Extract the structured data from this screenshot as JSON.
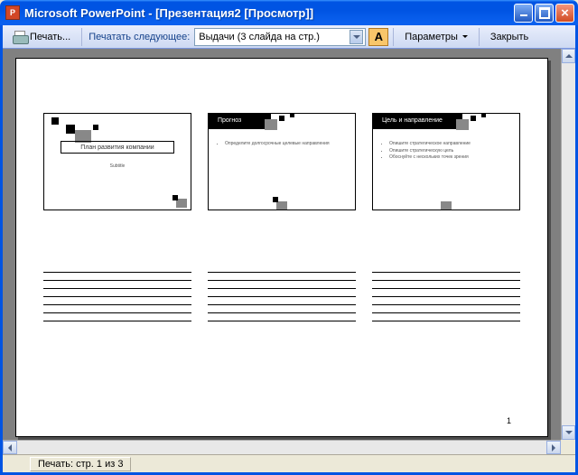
{
  "titlebar": {
    "title": "Microsoft PowerPoint - [Презентация2 [Просмотр]]"
  },
  "toolbar": {
    "print_label": "Печать...",
    "print_next_label": "Печатать следующее:",
    "select_value": "Выдачи (3 слайда на стр.)",
    "format_icon_text": "A",
    "params_label": "Параметры",
    "close_label": "Закрыть"
  },
  "page": {
    "number": "1"
  },
  "slides": [
    {
      "title": "План развития компании",
      "subtitle": "Subtitle",
      "bullets": []
    },
    {
      "title": "Прогноз",
      "subtitle": "",
      "bullets": [
        "Определите долгосрочные целевые направления"
      ]
    },
    {
      "title": "Цель и направление",
      "subtitle": "",
      "bullets": [
        "Опишите стратегическое направление",
        "Опишите стратегическую цель",
        "Обоснуйте с нескольких точек зрения"
      ]
    }
  ],
  "statusbar": {
    "text": "Печать: стр. 1 из 3"
  }
}
